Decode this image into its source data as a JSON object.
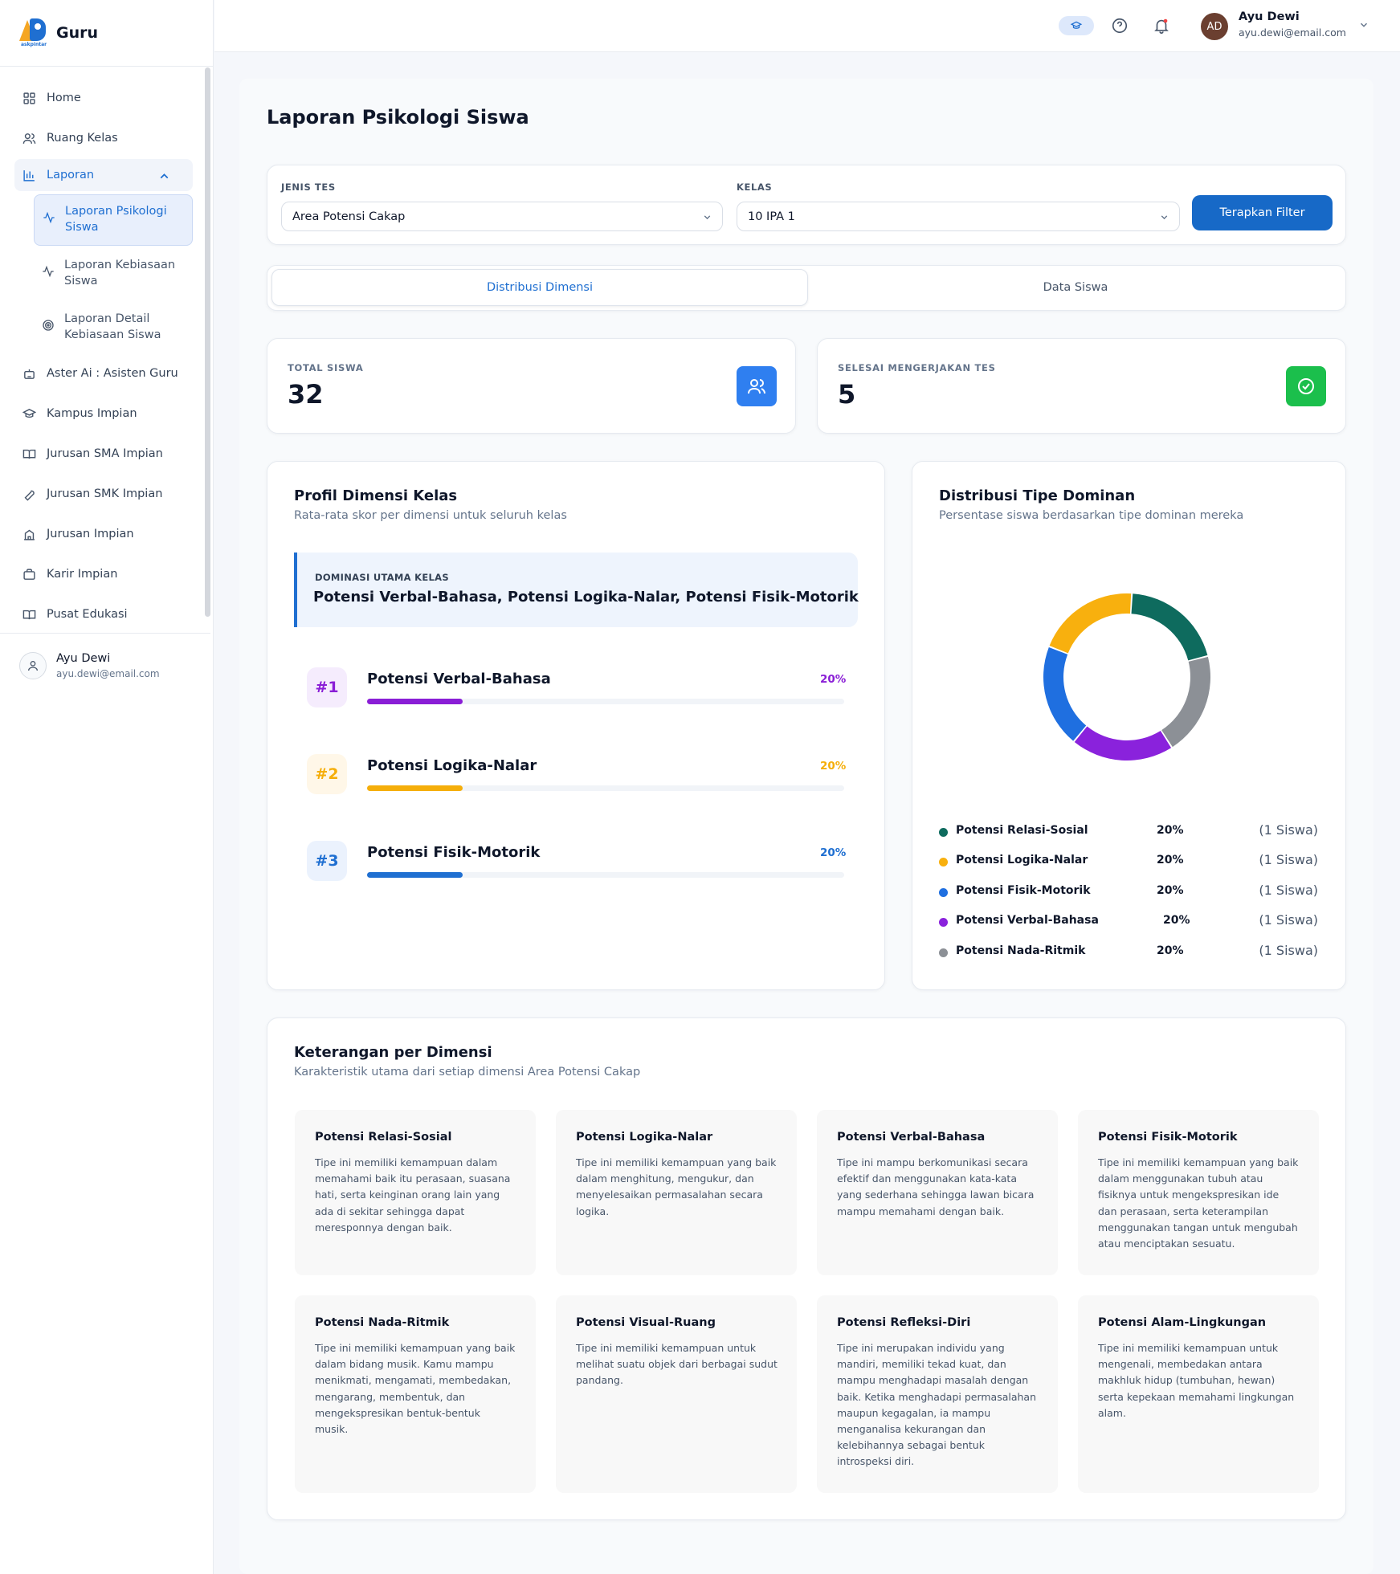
{
  "app": {
    "name": "Guru",
    "logo_small": "askpintar"
  },
  "sidebar": {
    "items": [
      {
        "label": "Home",
        "icon": "grid-icon"
      },
      {
        "label": "Ruang Kelas",
        "icon": "users-icon"
      },
      {
        "label": "Laporan",
        "icon": "bar-chart-icon"
      },
      {
        "label": "Aster Ai : Asisten Guru",
        "icon": "robot-icon"
      },
      {
        "label": "Kampus Impian",
        "icon": "graduation-cap-icon"
      },
      {
        "label": "Jurusan SMA Impian",
        "icon": "book-open-icon"
      },
      {
        "label": "Jurusan SMK Impian",
        "icon": "wrench-icon"
      },
      {
        "label": "Jurusan Impian",
        "icon": "school-icon"
      },
      {
        "label": "Karir Impian",
        "icon": "briefcase-icon"
      },
      {
        "label": "Pusat Edukasi",
        "icon": "book-icon"
      }
    ],
    "subitems": [
      {
        "label": "Laporan Psikologi Siswa",
        "icon": "activity-icon"
      },
      {
        "label": "Laporan Kebiasaan Siswa",
        "icon": "activity-icon"
      },
      {
        "label": "Laporan Detail Kebiasaan Siswa",
        "icon": "target-icon"
      }
    ],
    "user": {
      "name": "Ayu Dewi",
      "email": "ayu.dewi@email.com"
    }
  },
  "topbar": {
    "user_initials": "AD",
    "user_name": "Ayu Dewi",
    "user_email": "ayu.dewi@email.com"
  },
  "page": {
    "title": "Laporan Psikologi Siswa"
  },
  "filters": {
    "jenis_label": "JENIS TES",
    "jenis_value": "Area Potensi Cakap",
    "kelas_label": "KELAS",
    "kelas_value": "10 IPA 1",
    "apply_label": "Terapkan Filter"
  },
  "tabs": [
    {
      "label": "Distribusi Dimensi",
      "active": true
    },
    {
      "label": "Data Siswa",
      "active": false
    }
  ],
  "stats": {
    "total_label": "TOTAL SISWA",
    "total_value": "32",
    "done_label": "SELESAI MENGERJAKAN TES",
    "done_value": "5"
  },
  "profile": {
    "title": "Profil Dimensi Kelas",
    "subtitle": "Rata-rata skor per dimensi untuk seluruh kelas",
    "dominant_label": "DOMINASI UTAMA KELAS",
    "dominant_value": "Potensi Verbal-Bahasa, Potensi Logika-Nalar, Potensi Fisik-Motorik",
    "ranks": [
      {
        "rank": "#1",
        "name": "Potensi Verbal-Bahasa",
        "pct": "20%",
        "value": 0.2,
        "color": "#8a1ed6",
        "badge_bg": "#f5ecfd"
      },
      {
        "rank": "#2",
        "name": "Potensi Logika-Nalar",
        "pct": "20%",
        "value": 0.2,
        "color": "#f5ae0a",
        "badge_bg": "#fff7e8"
      },
      {
        "rank": "#3",
        "name": "Potensi Fisik-Motorik",
        "pct": "20%",
        "value": 0.2,
        "color": "#1f6fd1",
        "badge_bg": "#ebf2fd"
      }
    ]
  },
  "distribution": {
    "title": "Distribusi Tipe Dominan",
    "subtitle": "Persentase siswa berdasarkan tipe dominan mereka",
    "legend": [
      {
        "name": "Potensi Relasi-Sosial",
        "pct": "20%",
        "count": "(1 Siswa)",
        "color": "#0e6b5e"
      },
      {
        "name": "Potensi Logika-Nalar",
        "pct": "20%",
        "count": "(1 Siswa)",
        "color": "#f8b00e"
      },
      {
        "name": "Potensi Fisik-Motorik",
        "pct": "20%",
        "count": "(1 Siswa)",
        "color": "#1f6fe0"
      },
      {
        "name": "Potensi Verbal-Bahasa",
        "pct": "20%",
        "count": "(1 Siswa)",
        "color": "#8a22dc"
      },
      {
        "name": "Potensi Nada-Ritmik",
        "pct": "20%",
        "count": "(1 Siswa)",
        "color": "#8c9096"
      }
    ]
  },
  "chart_data": {
    "type": "pie",
    "categories": [
      "Potensi Relasi-Sosial",
      "Potensi Nada-Ritmik",
      "Potensi Verbal-Bahasa",
      "Potensi Fisik-Motorik",
      "Potensi Logika-Nalar"
    ],
    "values": [
      20,
      20,
      20,
      20,
      20
    ],
    "colors": [
      "#0e6b5e",
      "#8c9096",
      "#8a22dc",
      "#1f6fe0",
      "#f8b00e"
    ],
    "title": "Distribusi Tipe Dominan",
    "style": "donut"
  },
  "descriptions": {
    "title": "Keterangan per Dimensi",
    "subtitle": "Karakteristik utama dari setiap dimensi Area Potensi Cakap",
    "items": [
      {
        "title": "Potensi Relasi-Sosial",
        "text": "Tipe ini memiliki kemampuan dalam memahami baik itu perasaan, suasana hati, serta keinginan orang lain yang ada di sekitar sehingga dapat meresponnya dengan baik."
      },
      {
        "title": "Potensi Logika-Nalar",
        "text": "Tipe ini memiliki kemampuan yang baik dalam menghitung, mengukur, dan menyelesaikan permasalahan secara logika."
      },
      {
        "title": "Potensi Verbal-Bahasa",
        "text": "Tipe ini mampu berkomunikasi secara efektif dan menggunakan kata-kata yang sederhana sehingga lawan bicara mampu memahami dengan baik."
      },
      {
        "title": "Potensi Fisik-Motorik",
        "text": "Tipe ini memiliki kemampuan yang baik dalam menggunakan tubuh atau fisiknya untuk mengekspresikan ide dan perasaan, serta keterampilan menggunakan tangan untuk mengubah atau menciptakan sesuatu."
      },
      {
        "title": "Potensi Nada-Ritmik",
        "text": "Tipe ini memiliki kemampuan yang baik dalam bidang musik. Kamu mampu menikmati, mengamati, membedakan, mengarang, membentuk, dan mengekspresikan bentuk-bentuk musik."
      },
      {
        "title": "Potensi Visual-Ruang",
        "text": "Tipe ini memiliki kemampuan untuk melihat suatu objek dari berbagai sudut pandang."
      },
      {
        "title": "Potensi Refleksi-Diri",
        "text": "Tipe ini merupakan individu yang mandiri, memiliki tekad kuat, dan mampu menghadapi masalah dengan baik. Ketika menghadapi permasalahan maupun kegagalan, ia mampu menganalisa kekurangan dan kelebihannya sebagai bentuk introspeksi diri."
      },
      {
        "title": "Potensi Alam-Lingkungan",
        "text": "Tipe ini memiliki kemampuan untuk mengenali, membedakan antara makhluk hidup (tumbuhan, hewan) serta kepekaan memahami lingkungan alam."
      }
    ]
  }
}
